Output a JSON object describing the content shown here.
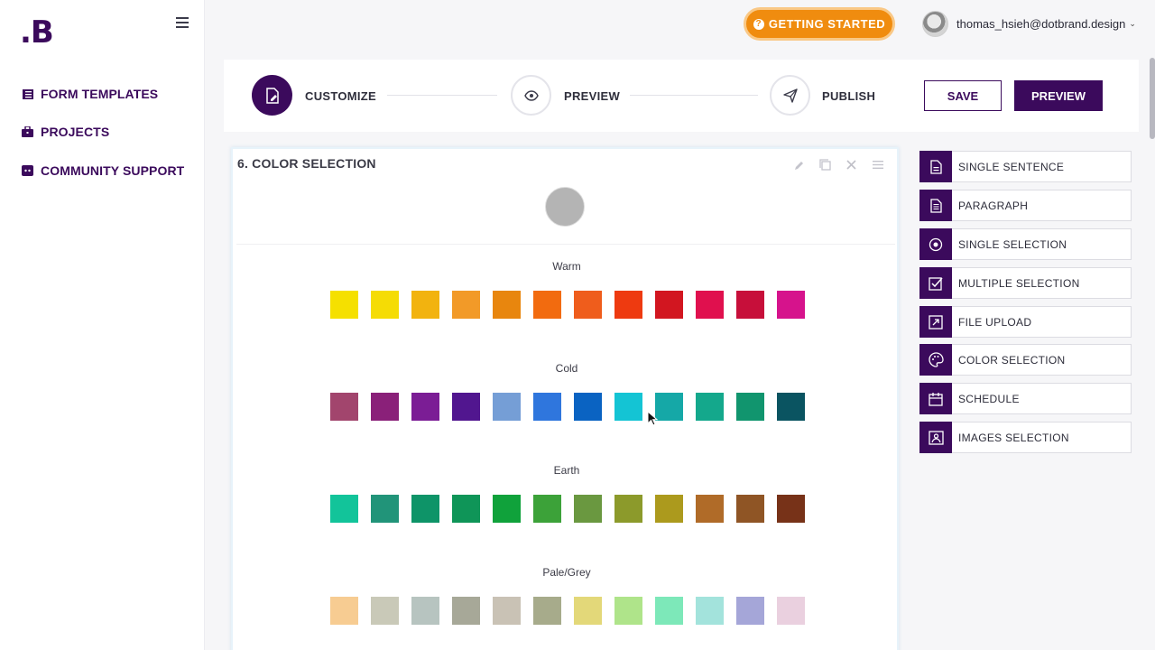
{
  "brand": {
    "logo": ".B"
  },
  "sidebar": {
    "items": [
      {
        "label": "FORM TEMPLATES",
        "icon": "list-icon"
      },
      {
        "label": "PROJECTS",
        "icon": "briefcase-icon"
      },
      {
        "label": "COMMUNITY SUPPORT",
        "icon": "discord-icon"
      }
    ]
  },
  "topbar": {
    "getting_started": "GETTING STARTED",
    "getting_started_icon": "?",
    "user_email": "thomas_hsieh@dotbrand.design",
    "chevron": "⌄"
  },
  "stepper": {
    "steps": [
      {
        "label": "CUSTOMIZE",
        "icon": "edit-doc-icon",
        "active": true
      },
      {
        "label": "PREVIEW",
        "icon": "eye-icon",
        "active": false
      },
      {
        "label": "PUBLISH",
        "icon": "send-icon",
        "active": false
      }
    ],
    "save_label": "SAVE",
    "preview_label": "PREVIEW"
  },
  "question": {
    "title": "6. COLOR SELECTION",
    "selected_color": "#b4b4b4",
    "groups": [
      {
        "name": "Warm",
        "colors": [
          "#f5e000",
          "#f5dc05",
          "#f2b30f",
          "#f29a28",
          "#e8860e",
          "#f26b0f",
          "#ef5d1c",
          "#ee3a10",
          "#d21620",
          "#e0104e",
          "#c70f3a",
          "#d6138c"
        ]
      },
      {
        "name": "Cold",
        "colors": [
          "#a2456d",
          "#8a2079",
          "#7b1d95",
          "#51168f",
          "#759ed6",
          "#2f76dd",
          "#0a63c2",
          "#14c4d4",
          "#15a8a7",
          "#14a88c",
          "#11956e",
          "#0a5461"
        ]
      },
      {
        "name": "Earth",
        "colors": [
          "#12c49a",
          "#219479",
          "#0e9468",
          "#0f9558",
          "#10a23b",
          "#3ca239",
          "#6a9840",
          "#8c9a2b",
          "#ac9a1d",
          "#b06b28",
          "#8f5525",
          "#773218"
        ]
      },
      {
        "name": "Pale/Grey",
        "colors": [
          "#f7cc92",
          "#c9c9b8",
          "#b7c4c0",
          "#a7a898",
          "#c9c2b5",
          "#a7ab8b",
          "#e3d879",
          "#afe48a",
          "#7de8b9",
          "#a3e3dc",
          "#a5a6d8",
          "#ead0df"
        ]
      }
    ]
  },
  "palette": {
    "items": [
      {
        "label": "SINGLE SENTENCE",
        "icon": "doc-icon"
      },
      {
        "label": "PARAGRAPH",
        "icon": "paragraph-doc-icon"
      },
      {
        "label": "SINGLE SELECTION",
        "icon": "radio-icon"
      },
      {
        "label": "MULTIPLE SELECTION",
        "icon": "checkbox-icon"
      },
      {
        "label": "FILE UPLOAD",
        "icon": "upload-icon"
      },
      {
        "label": "COLOR SELECTION",
        "icon": "palette-icon"
      },
      {
        "label": "SCHEDULE",
        "icon": "calendar-icon"
      },
      {
        "label": "IMAGES SELECTION",
        "icon": "image-icon"
      }
    ]
  },
  "colors": {
    "brand": "#3b0a5c",
    "accent": "#f08c0f"
  }
}
